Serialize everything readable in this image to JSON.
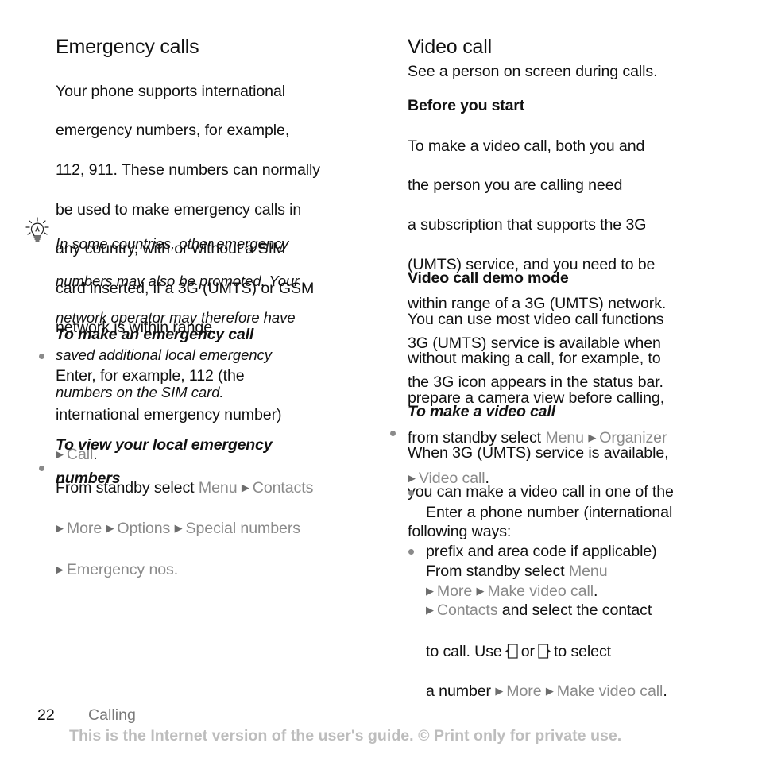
{
  "left": {
    "title": "Emergency calls",
    "intro_lines": [
      "Your phone supports international",
      "emergency numbers, for example,",
      "112, 911. These numbers can normally",
      "be used to make emergency calls in",
      "any country, with or without a SIM",
      "card inserted, if a 3G (UMTS) or GSM",
      "network is within range."
    ],
    "tip_icon": "lightbulb-icon",
    "tip_lines": [
      "In some countries, other emergency",
      "numbers may also be promoted. Your",
      "network operator may therefore have",
      "saved additional local emergency",
      "numbers on the SIM card."
    ],
    "make_call": {
      "heading": "To make an emergency call",
      "line1": "Enter, for example, 112 (the",
      "line2": "international emergency number)",
      "path": [
        "Call"
      ],
      "end": "."
    },
    "view_numbers": {
      "heading_line1": "To view your local emergency",
      "heading_line2": "numbers",
      "prefix": "From standby select",
      "path": [
        "Menu",
        "Contacts",
        "More",
        "Options",
        "Special numbers",
        "Emergency nos."
      ]
    }
  },
  "right": {
    "title": "Video call",
    "intro": "See a person on screen during calls.",
    "before": {
      "heading": "Before you start",
      "lines": [
        "To make a video call, both you and",
        "the person you are calling need",
        "a subscription that supports the 3G",
        "(UMTS) service, and you need to be",
        "within range of a 3G (UMTS) network.",
        "3G (UMTS) service is available when",
        "the 3G icon appears in the status bar."
      ]
    },
    "demo": {
      "heading": "Video call demo mode",
      "lines": [
        "You can use most video call functions",
        "without making a call, for example, to",
        "prepare a camera view before calling,"
      ],
      "prefix": "from standby select",
      "path": [
        "Menu",
        "Organizer",
        "Video call"
      ],
      "end": "."
    },
    "make_video": {
      "heading": "To make a video call",
      "lines": [
        "When 3G (UMTS) service is available,",
        "you can make a video call in one of the",
        "following ways:"
      ],
      "option1": {
        "line1": "Enter a phone number (international",
        "line2": "prefix and area code if applicable)",
        "path": [
          "More",
          "Make video call"
        ],
        "end": "."
      },
      "option2": {
        "prefix": "From standby select",
        "path1": "Menu",
        "path2": "Contacts",
        "mid": "and select the contact",
        "use": "to call. Use",
        "or": "or",
        "to_select": "to select",
        "a_number": "a number",
        "path3": [
          "More",
          "Make video call"
        ],
        "end": ".",
        "left_key_icon": "left-nav-key-icon",
        "right_key_icon": "right-nav-key-icon"
      }
    }
  },
  "footer": {
    "page_number": "22",
    "section": "Calling",
    "notice": "This is the Internet version of the user's guide. © Print only for private use."
  },
  "colors": {
    "text": "#111111",
    "menu_path": "#8a8a8a",
    "notice": "#bdbdbd"
  }
}
